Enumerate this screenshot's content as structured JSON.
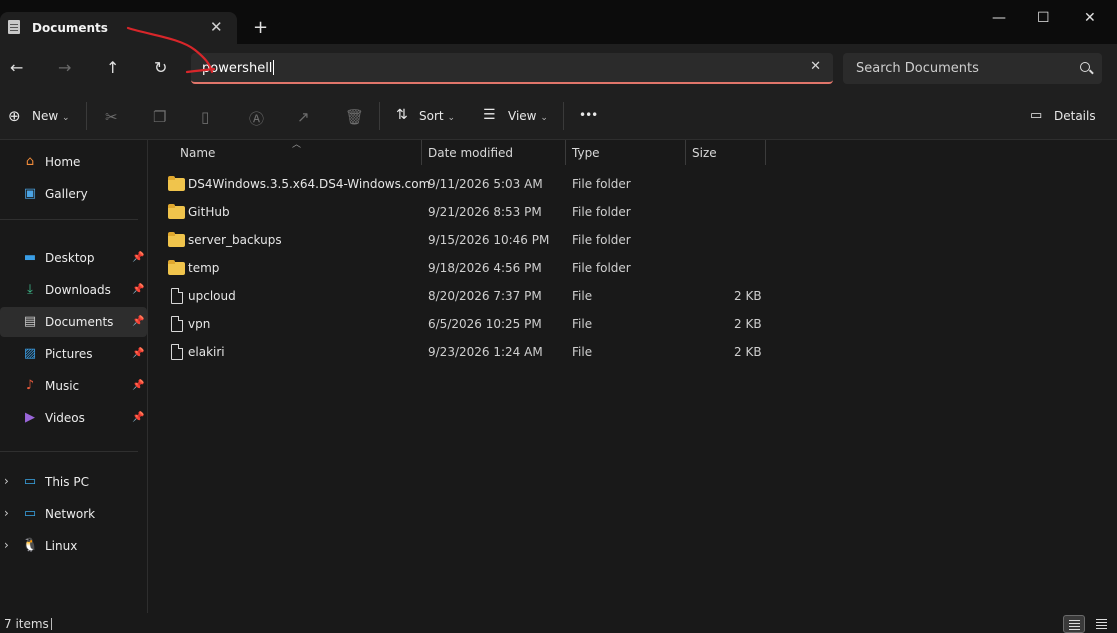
{
  "tab": {
    "title": "Documents",
    "close": "✕",
    "new_tab": "+"
  },
  "window_controls": {
    "minimize": "—",
    "maximize": "☐",
    "close": "✕"
  },
  "nav": {
    "back": "←",
    "forward": "→",
    "up": "↑",
    "refresh": "↻"
  },
  "address": {
    "value": "powershell",
    "clear": "✕"
  },
  "search": {
    "placeholder": "Search Documents"
  },
  "commands": {
    "new_label": "New",
    "sort_label": "Sort",
    "view_label": "View",
    "more_label": "•••",
    "details_label": "Details"
  },
  "sidebar": {
    "quick": [
      {
        "label": "Home",
        "icon": "home-icon"
      },
      {
        "label": "Gallery",
        "icon": "gallery-icon"
      }
    ],
    "pinned": [
      {
        "label": "Desktop",
        "icon": "desktop-icon"
      },
      {
        "label": "Downloads",
        "icon": "downloads-icon"
      },
      {
        "label": "Documents",
        "icon": "documents-icon"
      },
      {
        "label": "Pictures",
        "icon": "pictures-icon"
      },
      {
        "label": "Music",
        "icon": "music-icon"
      },
      {
        "label": "Videos",
        "icon": "videos-icon"
      }
    ],
    "locations": [
      {
        "label": "This PC",
        "icon": "pc-icon"
      },
      {
        "label": "Network",
        "icon": "network-icon"
      },
      {
        "label": "Linux",
        "icon": "linux-icon"
      }
    ]
  },
  "columns": {
    "name": "Name",
    "date": "Date modified",
    "type": "Type",
    "size": "Size"
  },
  "files": [
    {
      "name": "DS4Windows.3.5.x64.DS4-Windows.com",
      "date": "9/11/2026 5:03 AM",
      "type": "File folder",
      "size": "",
      "kind": "folder"
    },
    {
      "name": "GitHub",
      "date": "9/21/2026 8:53 PM",
      "type": "File folder",
      "size": "",
      "kind": "folder"
    },
    {
      "name": "server_backups",
      "date": "9/15/2026 10:46 PM",
      "type": "File folder",
      "size": "",
      "kind": "folder"
    },
    {
      "name": "temp",
      "date": "9/18/2026 4:56 PM",
      "type": "File folder",
      "size": "",
      "kind": "folder"
    },
    {
      "name": "upcloud",
      "date": "8/20/2026 7:37 PM",
      "type": "File",
      "size": "2 KB",
      "kind": "file"
    },
    {
      "name": "vpn",
      "date": "6/5/2026 10:25 PM",
      "type": "File",
      "size": "2 KB",
      "kind": "file"
    },
    {
      "name": "elakiri",
      "date": "9/23/2026 1:24 AM",
      "type": "File",
      "size": "2 KB",
      "kind": "file"
    }
  ],
  "status": {
    "item_count": "7 items"
  },
  "colors": {
    "accent_underline": "#e0756a",
    "annotation_red": "#d8262a",
    "folder": "#f0c44c"
  }
}
